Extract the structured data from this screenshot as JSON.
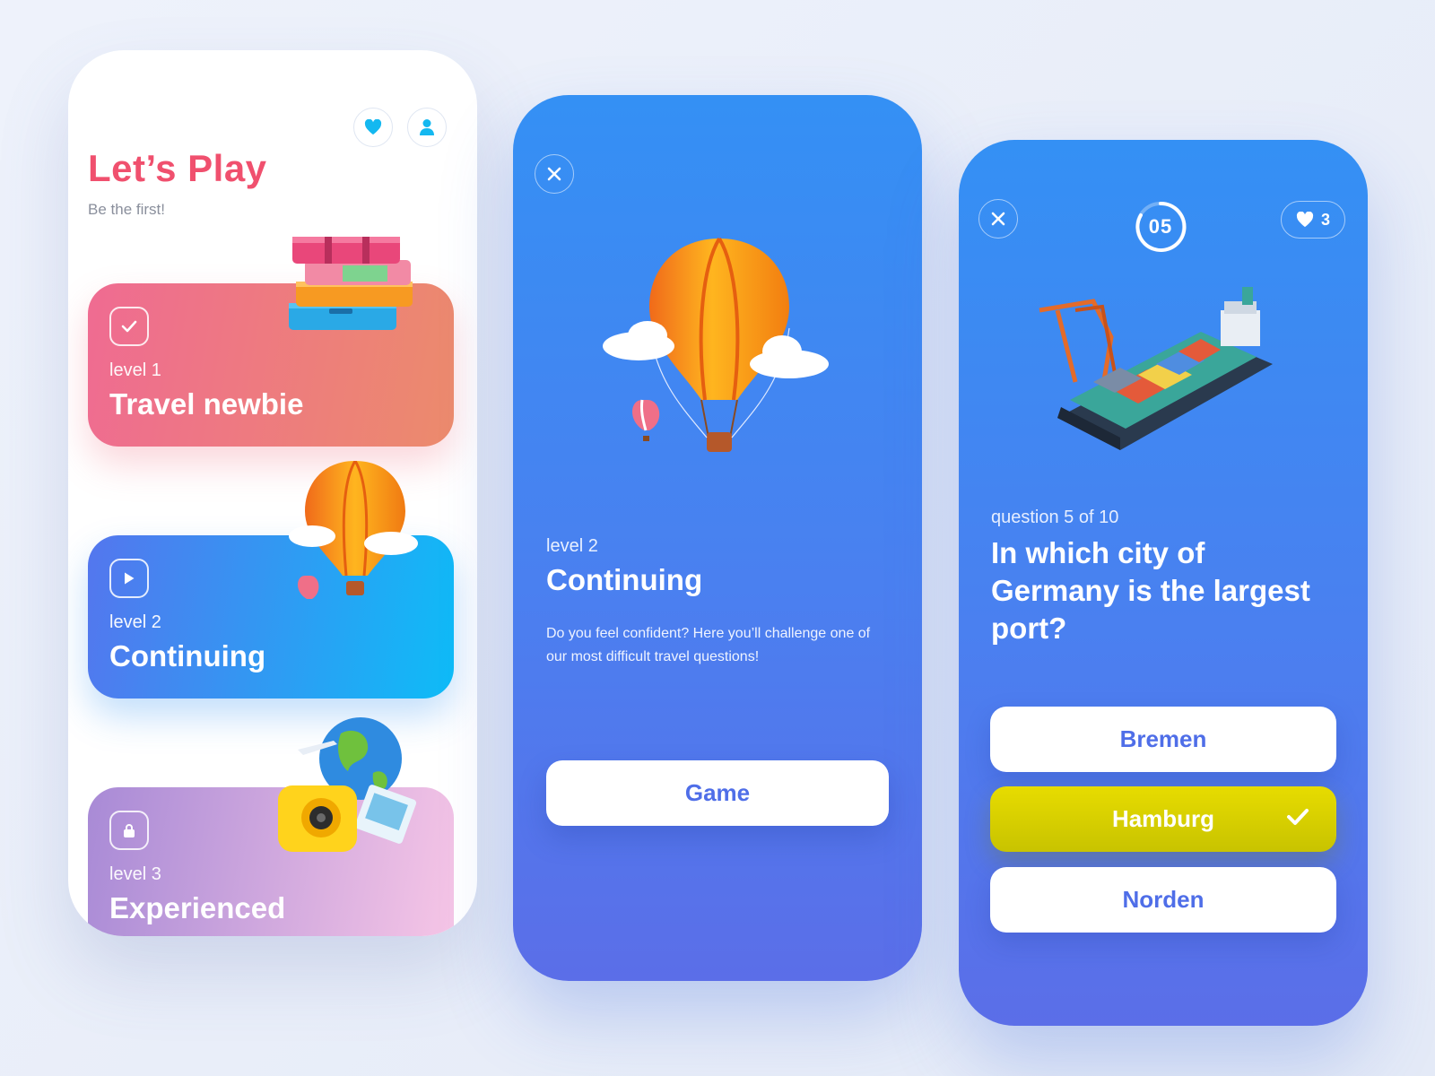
{
  "screen1": {
    "title": "Let’s Play",
    "subtitle": "Be the first!",
    "header_icons": [
      "heart-icon",
      "user-icon"
    ],
    "levels": [
      {
        "level": "level 1",
        "name": "Travel newbie",
        "status_icon": "check-icon"
      },
      {
        "level": "level 2",
        "name": "Continuing",
        "status_icon": "play-icon"
      },
      {
        "level": "level 3",
        "name": "Experienced",
        "status_icon": "lock-icon"
      }
    ]
  },
  "screen2": {
    "level": "level 2",
    "name": "Continuing",
    "description": "Do you feel confident? Here you’ll challenge one of our most difficult travel questions!",
    "button": "Game"
  },
  "screen3": {
    "timer": "05",
    "lives": "3",
    "question_counter": "question 5 of 10",
    "question": "In which city of Germany is the largest port?",
    "answers": [
      {
        "label": "Bremen",
        "state": "default"
      },
      {
        "label": "Hamburg",
        "state": "correct"
      },
      {
        "label": "Norden",
        "state": "default"
      }
    ]
  },
  "colors": {
    "title_pink": "#f0506e",
    "blue_start": "#3490f4",
    "blue_end": "#5b6ee8",
    "correct_yellow": "#dcd400",
    "answer_text": "#4f6ee8"
  }
}
